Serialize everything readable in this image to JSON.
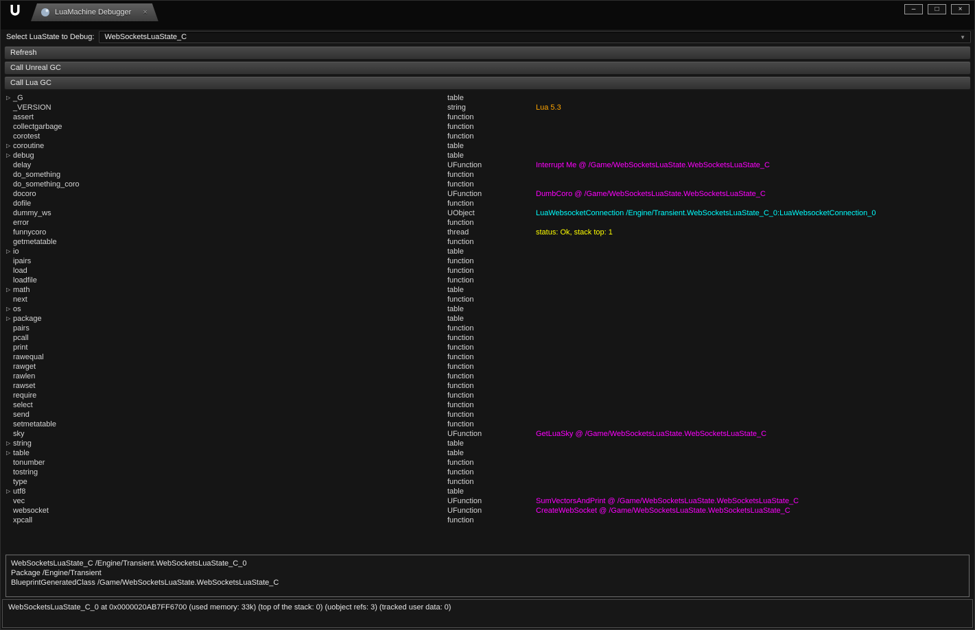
{
  "window": {
    "tab": {
      "title": "LuaMachine Debugger",
      "close_glyph": "×"
    },
    "controls": {
      "minimize": "–",
      "restore": "□",
      "close": "×"
    }
  },
  "toolbar": {
    "select_label": "Select LuaState to Debug:",
    "selected_state": "WebSocketsLuaState_C",
    "dropdown_arrow": "▼",
    "buttons": [
      "Refresh",
      "Call Unreal GC",
      "Call Lua GC"
    ]
  },
  "colors": {
    "string_value": "#FFA500",
    "ufunction_value": "#FF00FF",
    "uobject_value": "#00FFFF",
    "thread_value": "#FFFF00",
    "default_text": "#D4D4D4"
  },
  "tree": {
    "expander_glyph": "▷",
    "rows": [
      {
        "name": "_G",
        "type": "table",
        "expandable": true
      },
      {
        "name": "_VERSION",
        "type": "string",
        "value": "Lua 5.3",
        "value_color": "#FFA500"
      },
      {
        "name": "assert",
        "type": "function"
      },
      {
        "name": "collectgarbage",
        "type": "function"
      },
      {
        "name": "corotest",
        "type": "function"
      },
      {
        "name": "coroutine",
        "type": "table",
        "expandable": true
      },
      {
        "name": "debug",
        "type": "table",
        "expandable": true
      },
      {
        "name": "delay",
        "type": "UFunction",
        "value": "Interrupt Me @ /Game/WebSocketsLuaState.WebSocketsLuaState_C",
        "value_color": "#FF00FF"
      },
      {
        "name": "do_something",
        "type": "function"
      },
      {
        "name": "do_something_coro",
        "type": "function"
      },
      {
        "name": "docoro",
        "type": "UFunction",
        "value": "DumbCoro @ /Game/WebSocketsLuaState.WebSocketsLuaState_C",
        "value_color": "#FF00FF"
      },
      {
        "name": "dofile",
        "type": "function"
      },
      {
        "name": "dummy_ws",
        "type": "UObject",
        "value": "LuaWebsocketConnection /Engine/Transient.WebSocketsLuaState_C_0:LuaWebsocketConnection_0",
        "value_color": "#00FFFF"
      },
      {
        "name": "error",
        "type": "function"
      },
      {
        "name": "funnycoro",
        "type": "thread",
        "value": "status: Ok, stack top: 1",
        "value_color": "#FFFF00"
      },
      {
        "name": "getmetatable",
        "type": "function"
      },
      {
        "name": "io",
        "type": "table",
        "expandable": true
      },
      {
        "name": "ipairs",
        "type": "function"
      },
      {
        "name": "load",
        "type": "function"
      },
      {
        "name": "loadfile",
        "type": "function"
      },
      {
        "name": "math",
        "type": "table",
        "expandable": true
      },
      {
        "name": "next",
        "type": "function"
      },
      {
        "name": "os",
        "type": "table",
        "expandable": true
      },
      {
        "name": "package",
        "type": "table",
        "expandable": true
      },
      {
        "name": "pairs",
        "type": "function"
      },
      {
        "name": "pcall",
        "type": "function"
      },
      {
        "name": "print",
        "type": "function"
      },
      {
        "name": "rawequal",
        "type": "function"
      },
      {
        "name": "rawget",
        "type": "function"
      },
      {
        "name": "rawlen",
        "type": "function"
      },
      {
        "name": "rawset",
        "type": "function"
      },
      {
        "name": "require",
        "type": "function"
      },
      {
        "name": "select",
        "type": "function"
      },
      {
        "name": "send",
        "type": "function"
      },
      {
        "name": "setmetatable",
        "type": "function"
      },
      {
        "name": "sky",
        "type": "UFunction",
        "value": "GetLuaSky @ /Game/WebSocketsLuaState.WebSocketsLuaState_C",
        "value_color": "#FF00FF"
      },
      {
        "name": "string",
        "type": "table",
        "expandable": true
      },
      {
        "name": "table",
        "type": "table",
        "expandable": true
      },
      {
        "name": "tonumber",
        "type": "function"
      },
      {
        "name": "tostring",
        "type": "function"
      },
      {
        "name": "type",
        "type": "function"
      },
      {
        "name": "utf8",
        "type": "table",
        "expandable": true
      },
      {
        "name": "vec",
        "type": "UFunction",
        "value": "SumVectorsAndPrint @ /Game/WebSocketsLuaState.WebSocketsLuaState_C",
        "value_color": "#FF00FF"
      },
      {
        "name": "websocket",
        "type": "UFunction",
        "value": "CreateWebSocket @ /Game/WebSocketsLuaState.WebSocketsLuaState_C",
        "value_color": "#FF00FF"
      },
      {
        "name": "xpcall",
        "type": "function"
      }
    ]
  },
  "details": {
    "lines": [
      "WebSocketsLuaState_C /Engine/Transient.WebSocketsLuaState_C_0",
      "Package /Engine/Transient",
      "BlueprintGeneratedClass /Game/WebSocketsLuaState.WebSocketsLuaState_C"
    ]
  },
  "status_bar": {
    "text": "WebSocketsLuaState_C_0 at 0x0000020AB7FF6700 (used memory: 33k) (top of the stack: 0) (uobject refs: 3) (tracked user data: 0)"
  }
}
